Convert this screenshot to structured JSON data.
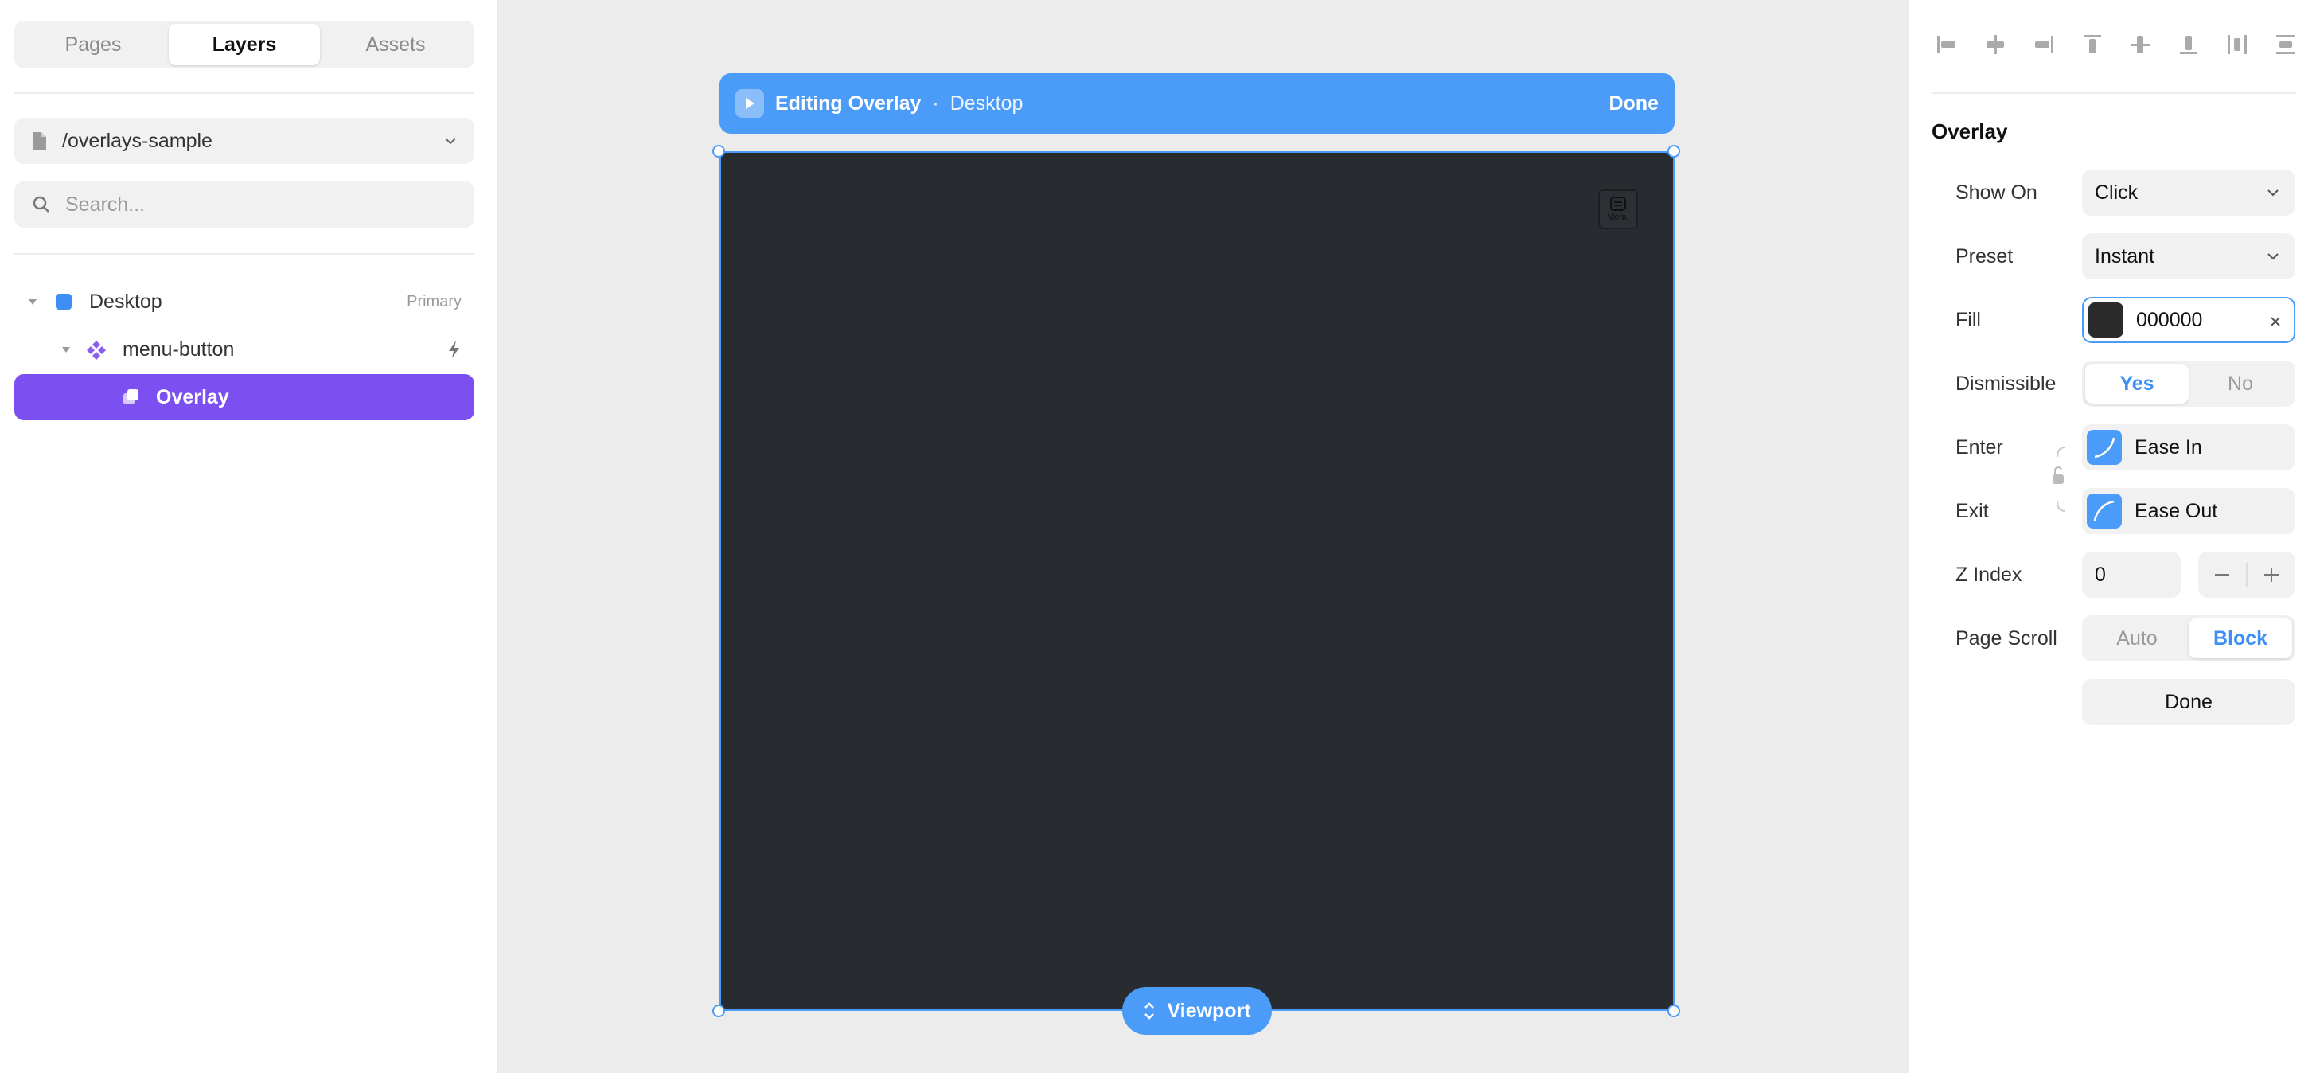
{
  "left_panel": {
    "tabs": [
      {
        "label": "Pages"
      },
      {
        "label": "Layers"
      },
      {
        "label": "Assets"
      }
    ],
    "path": "/overlays-sample",
    "search_placeholder": "Search...",
    "layers": [
      {
        "name": "Desktop",
        "tag": "Primary"
      },
      {
        "name": "menu-button"
      },
      {
        "name": "Overlay"
      }
    ]
  },
  "canvas": {
    "topbar": {
      "title": "Editing Overlay",
      "separator": "·",
      "context": "Desktop",
      "done_label": "Done"
    },
    "menu_button_label": "Menu",
    "viewport_label": "Viewport",
    "frame_color": "#282b30",
    "accent": "#4b9bf8"
  },
  "right_panel": {
    "section_title": "Overlay",
    "show_on": {
      "label": "Show On",
      "value": "Click"
    },
    "preset": {
      "label": "Preset",
      "value": "Instant"
    },
    "fill": {
      "label": "Fill",
      "value": "000000",
      "swatch": "#2b2b2b"
    },
    "dismissible": {
      "label": "Dismissible",
      "options": [
        "Yes",
        "No"
      ],
      "selected": "Yes"
    },
    "enter": {
      "label": "Enter",
      "value": "Ease In"
    },
    "exit": {
      "label": "Exit",
      "value": "Ease Out"
    },
    "z_index": {
      "label": "Z Index",
      "value": "0"
    },
    "page_scroll": {
      "label": "Page Scroll",
      "options": [
        "Auto",
        "Block"
      ],
      "selected": "Block"
    },
    "done_label": "Done"
  }
}
